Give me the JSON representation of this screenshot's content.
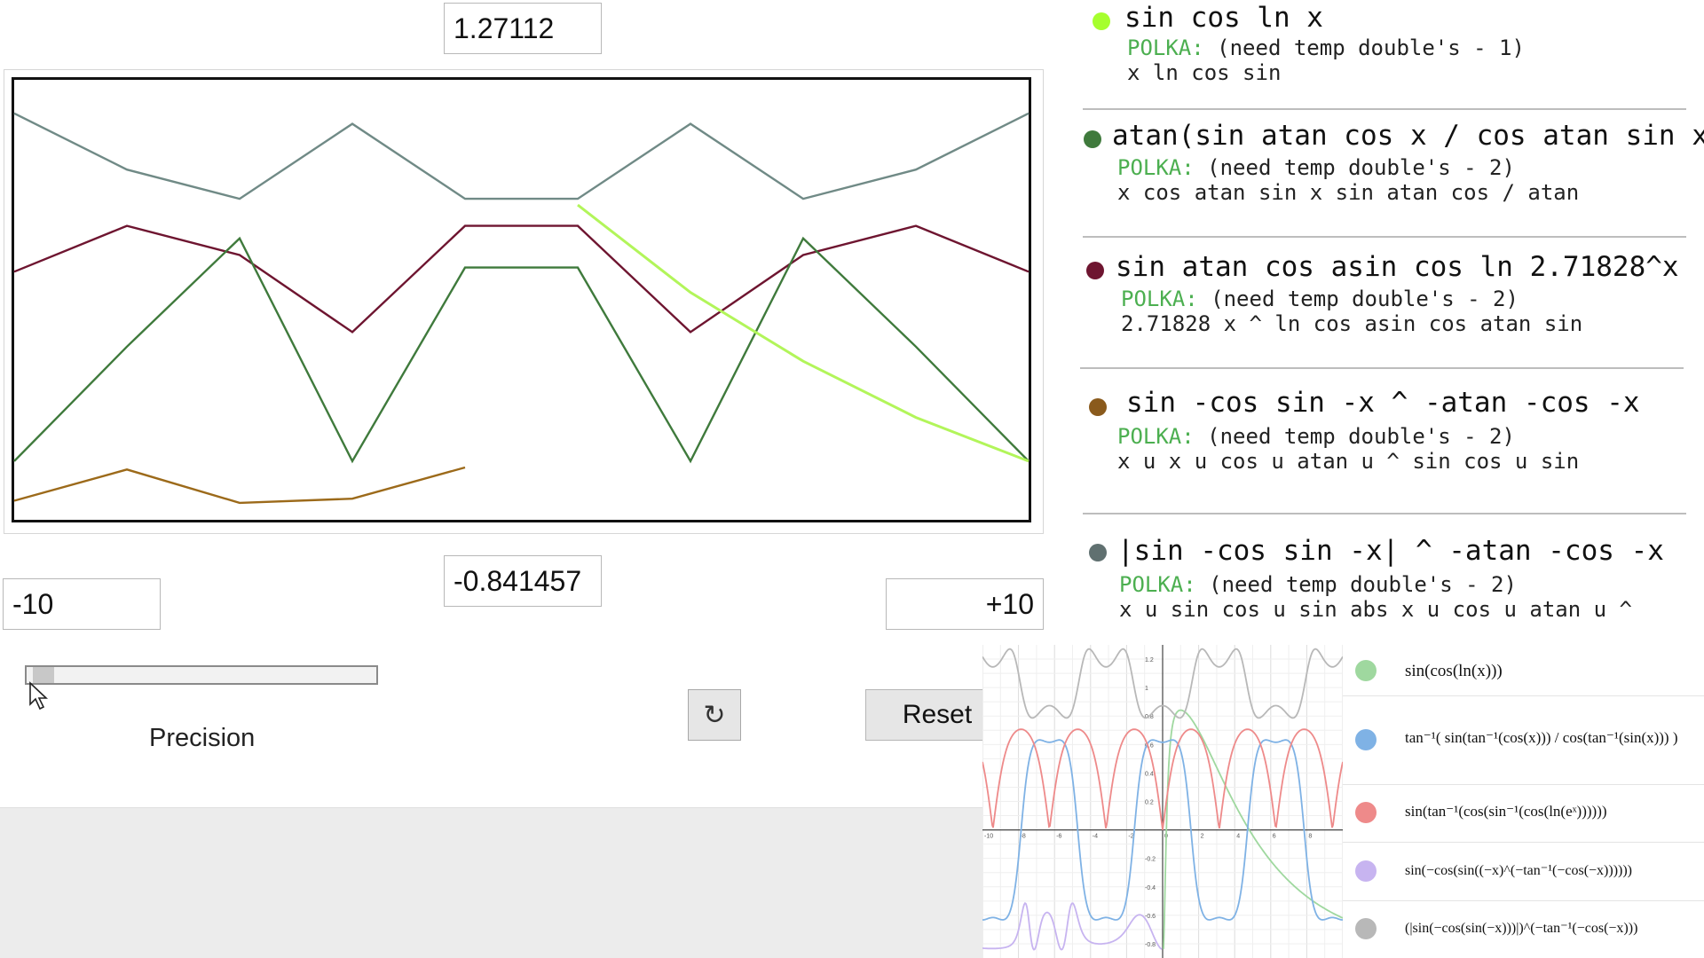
{
  "app": {
    "y_max_value": "1.27112",
    "y_min_value": "-0.841457",
    "x_min_value": "-10",
    "x_max_value": "+10",
    "precision_label": "Precision",
    "refresh_icon": "↻",
    "reset_label": "Reset",
    "precision_level": 0.02
  },
  "chart_data": {
    "type": "line",
    "x": [
      -10,
      -8,
      -6,
      -4,
      -2,
      0,
      2,
      4,
      6,
      8,
      10
    ],
    "ylim": [
      -0.841457,
      1.27112
    ],
    "series": [
      {
        "color": "#708a86",
        "values": [
          1.11,
          0.84,
          0.7,
          1.06,
          0.7,
          0.7,
          1.06,
          0.7,
          0.84,
          1.11
        ]
      },
      {
        "color": "#6e1530",
        "values": [
          0.35,
          0.57,
          0.43,
          0.06,
          0.57,
          0.57,
          0.06,
          0.43,
          0.57,
          0.35
        ]
      },
      {
        "color": "#3f7a3c",
        "values": [
          -0.56,
          -0.01,
          0.51,
          -0.56,
          0.37,
          0.37,
          -0.56,
          0.51,
          -0.01,
          -0.56
        ]
      },
      {
        "color": "#9c6a1a",
        "values": [
          -0.75,
          -0.6,
          -0.76,
          -0.74,
          -0.59
        ]
      },
      {
        "color": "#b2f55a",
        "values": [
          0.67,
          0.25,
          -0.08,
          -0.35,
          -0.56
        ]
      }
    ]
  },
  "functions": [
    {
      "color": "#a6ff2e",
      "title": "sin cos ln x",
      "polka_kw": "POLKA:",
      "polka": " (need temp double's - 1)",
      "rpn": "x ln cos sin"
    },
    {
      "color": "#3f7a3c",
      "title": "atan(sin atan cos x / cos atan sin x)",
      "polka_kw": "POLKA:",
      "polka": " (need temp double's - 2)",
      "rpn": "x cos atan sin x sin atan cos / atan"
    },
    {
      "color": "#6e1530",
      "title": "sin atan cos asin cos ln 2.71828^x",
      "polka_kw": "POLKA:",
      "polka": " (need temp double's - 2)",
      "rpn": "2.71828 x ^ ln cos asin cos atan sin"
    },
    {
      "color": "#8a5a1c",
      "title": "sin -cos sin -x ^ -atan -cos -x",
      "polka_kw": "POLKA:",
      "polka": " (need temp double's - 2)",
      "rpn": "x u x u cos u atan u ^ sin cos u sin"
    },
    {
      "color": "#607070",
      "title": "|sin -cos sin -x| ^ -atan -cos -x",
      "polka_kw": "POLKA:",
      "polka": " (need temp double's - 2)",
      "rpn": "x u sin cos u sin abs x u cos u atan u ^"
    }
  ],
  "geogebra": {
    "legend": [
      {
        "color": "#9fd89f",
        "text": "sin(cos(ln(x)))"
      },
      {
        "color": "#7fb2e5",
        "text": "tan⁻¹( sin(tan⁻¹(cos(x))) / cos(tan⁻¹(sin(x))) )"
      },
      {
        "color": "#ee8a8a",
        "text": "sin(tan⁻¹(cos(sin⁻¹(cos(ln(eˣ))))))"
      },
      {
        "color": "#c7b4f0",
        "text": "sin(−cos(sin((−x)^(−tan⁻¹(−cos(−x))))))"
      },
      {
        "color": "#b8b8b8",
        "text": "(|sin(−cos(sin(−x)))|)^(−tan⁻¹(−cos(−x)))"
      }
    ],
    "x_ticks": [
      "-10",
      "-8",
      "-6",
      "-4",
      "-2",
      "0",
      "2",
      "4",
      "6",
      "8",
      "10"
    ],
    "y_ticks": [
      "1.2",
      "1",
      "0.8",
      "0.6",
      "0.4",
      "0.2",
      "-0.2",
      "-0.4",
      "-0.6",
      "-0.8"
    ]
  }
}
